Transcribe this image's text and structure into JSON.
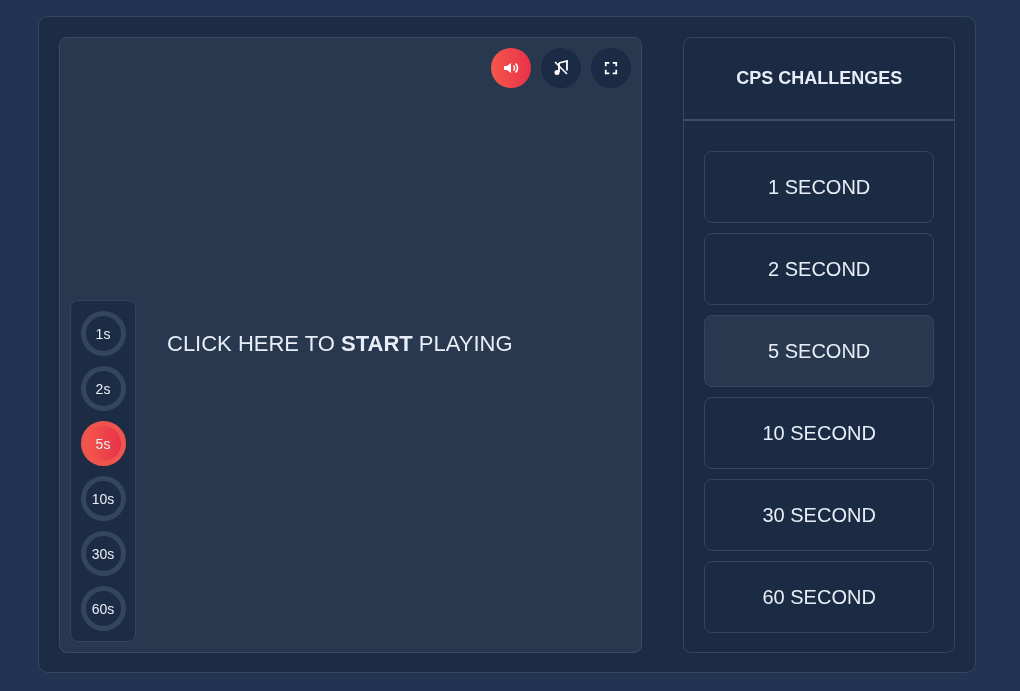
{
  "toolbar": [
    {
      "kind": "sound",
      "on": true
    },
    {
      "kind": "music",
      "on": false
    },
    {
      "kind": "fullscreen",
      "on": false
    }
  ],
  "timers": [
    {
      "label": "1s",
      "selected": false
    },
    {
      "label": "2s",
      "selected": false
    },
    {
      "label": "5s",
      "selected": true
    },
    {
      "label": "10s",
      "selected": false
    },
    {
      "label": "30s",
      "selected": false
    },
    {
      "label": "60s",
      "selected": false
    }
  ],
  "prompt": "CLICK HERE TO **START** PLAYING",
  "sidebar": {
    "title": "CPS CHALLENGES",
    "items": [
      {
        "label": "1 SECOND",
        "selected": false
      },
      {
        "label": "2 SECOND",
        "selected": false
      },
      {
        "label": "5 SECOND",
        "selected": true
      },
      {
        "label": "10 SECOND",
        "selected": false
      },
      {
        "label": "30 SECOND",
        "selected": false
      },
      {
        "label": "60 SECOND",
        "selected": false
      }
    ]
  }
}
